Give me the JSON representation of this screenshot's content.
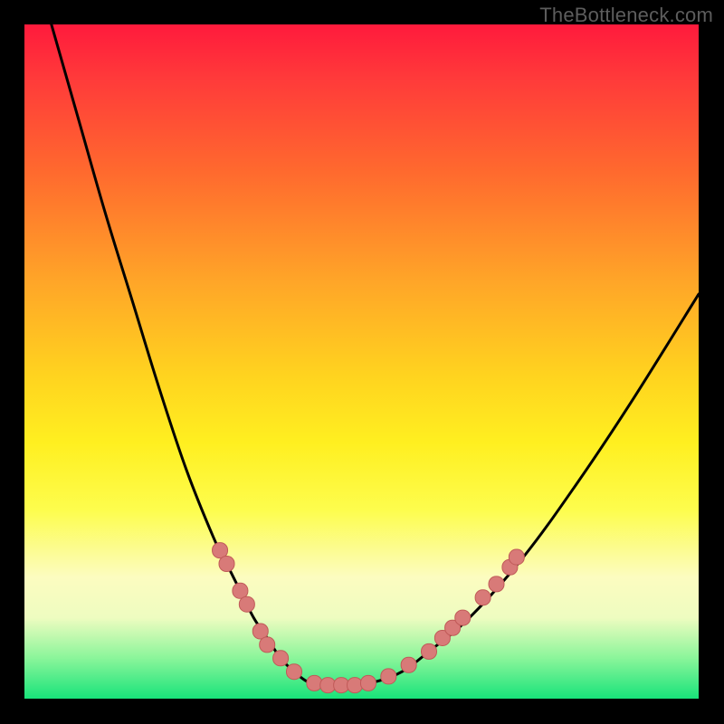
{
  "watermark": "TheBottleneck.com",
  "colors": {
    "background": "#000000",
    "curve": "#000000",
    "marker_fill": "#d87a78",
    "marker_stroke": "#c05a58"
  },
  "chart_data": {
    "type": "line",
    "title": "",
    "xlabel": "",
    "ylabel": "",
    "xlim": [
      0,
      100
    ],
    "ylim": [
      0,
      100
    ],
    "grid": false,
    "legend": false,
    "series": [
      {
        "name": "bottleneck-curve",
        "x": [
          4,
          8,
          12,
          16,
          20,
          24,
          28,
          30,
          32,
          34,
          36,
          38,
          40,
          42,
          44,
          46,
          48,
          52,
          56,
          60,
          66,
          74,
          82,
          90,
          100
        ],
        "y": [
          100,
          86,
          72,
          59,
          46,
          34,
          24,
          20,
          16,
          12,
          9,
          6,
          4,
          2.5,
          2,
          2,
          2,
          2.5,
          4,
          7,
          12,
          21,
          32,
          44,
          60
        ]
      }
    ],
    "markers": {
      "name": "curve-points",
      "shape": "rounded-square",
      "points": [
        {
          "x": 29,
          "y": 22
        },
        {
          "x": 30,
          "y": 20
        },
        {
          "x": 32,
          "y": 16
        },
        {
          "x": 33,
          "y": 14
        },
        {
          "x": 35,
          "y": 10
        },
        {
          "x": 36,
          "y": 8
        },
        {
          "x": 38,
          "y": 6
        },
        {
          "x": 40,
          "y": 4
        },
        {
          "x": 43,
          "y": 2.3
        },
        {
          "x": 45,
          "y": 2
        },
        {
          "x": 47,
          "y": 2
        },
        {
          "x": 49,
          "y": 2
        },
        {
          "x": 51,
          "y": 2.3
        },
        {
          "x": 54,
          "y": 3.3
        },
        {
          "x": 57,
          "y": 5
        },
        {
          "x": 60,
          "y": 7
        },
        {
          "x": 62,
          "y": 9
        },
        {
          "x": 63.5,
          "y": 10.5
        },
        {
          "x": 65,
          "y": 12
        },
        {
          "x": 68,
          "y": 15
        },
        {
          "x": 70,
          "y": 17
        },
        {
          "x": 72,
          "y": 19.5
        },
        {
          "x": 73,
          "y": 21
        }
      ]
    }
  }
}
